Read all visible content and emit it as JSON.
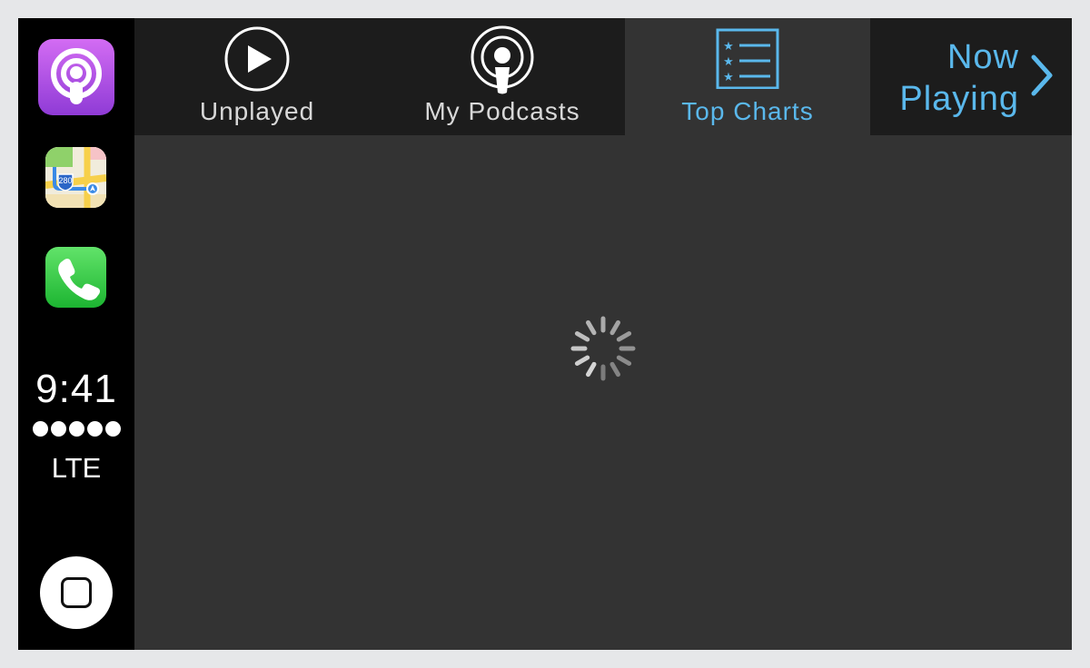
{
  "sidebar": {
    "apps": [
      {
        "name": "podcasts-app-icon"
      },
      {
        "name": "maps-app-icon",
        "route_label": "280"
      },
      {
        "name": "phone-app-icon"
      }
    ],
    "time": "9:41",
    "signal_bars": 5,
    "network": "LTE"
  },
  "tabs": [
    {
      "label": "Unplayed",
      "icon": "play-circle-icon",
      "active": false
    },
    {
      "label": "My Podcasts",
      "icon": "podcast-icon",
      "active": false
    },
    {
      "label": "Top Charts",
      "icon": "top-charts-icon",
      "active": true
    }
  ],
  "now_playing": {
    "line1": "Now",
    "line2": "Playing",
    "icon": "chevron-right-icon"
  },
  "main": {
    "state": "loading",
    "indicator": "spinner-icon"
  },
  "colors": {
    "accent": "#5ab8ec",
    "tabbar": "#1c1c1c",
    "content": "#333333",
    "frame": "#e6e7e9"
  }
}
